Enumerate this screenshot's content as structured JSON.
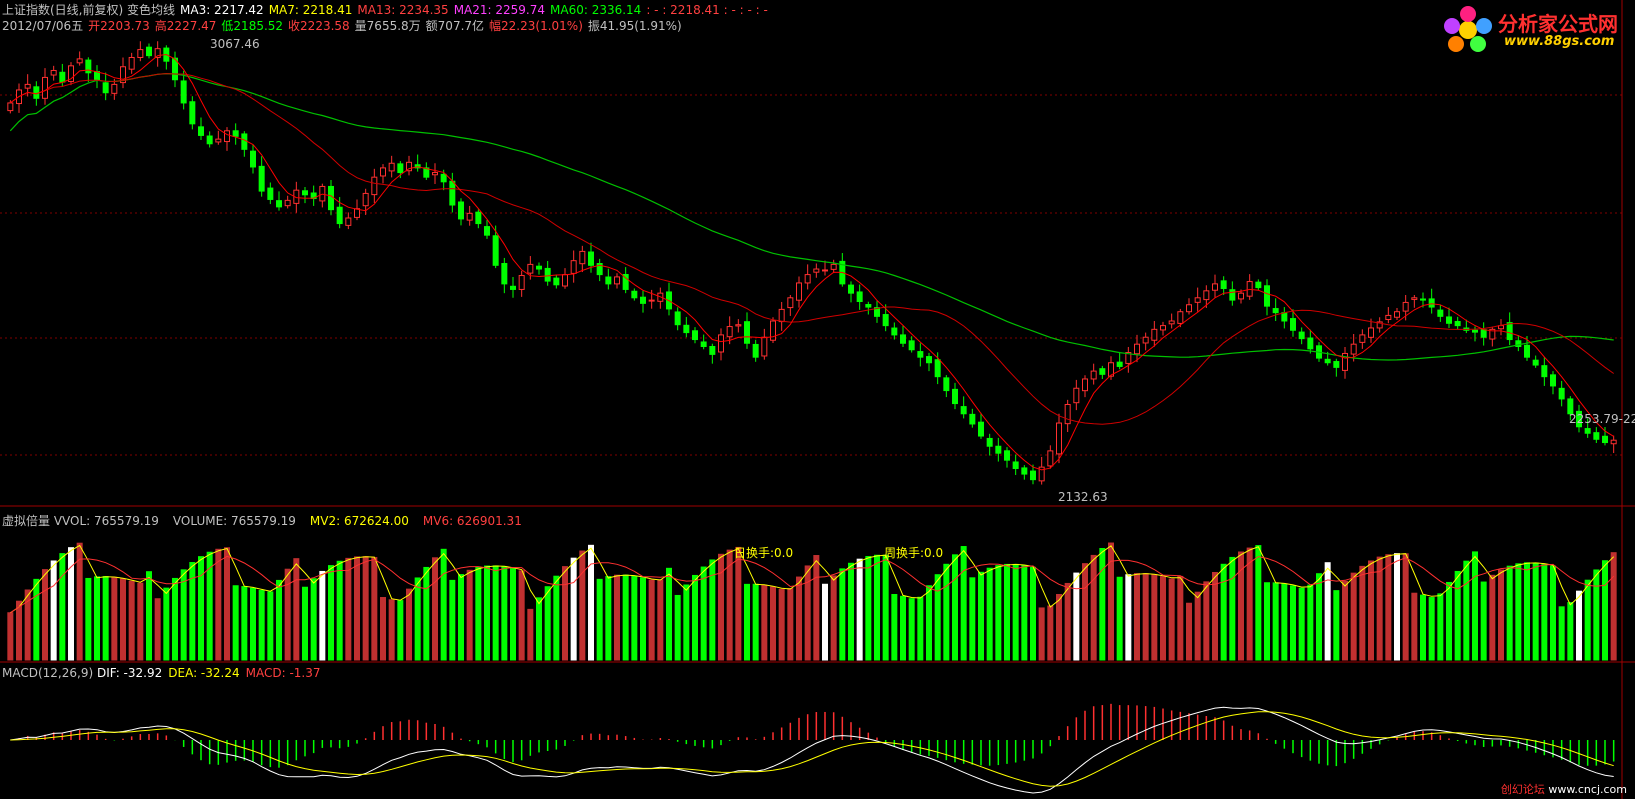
{
  "header": {
    "line1": [
      {
        "text": "上证指数(日线,前复权) 变色均线",
        "color": "#c0c0c0"
      },
      {
        "text": "MA3: 2217.42",
        "color": "#ffffff"
      },
      {
        "text": "MA7: 2218.41",
        "color": "#ffff00"
      },
      {
        "text": "MA13: 2234.35",
        "color": "#ff4040"
      },
      {
        "text": "MA21: 2259.74",
        "color": "#ff40ff"
      },
      {
        "text": "MA60: 2336.14",
        "color": "#00ff00"
      },
      {
        "text": ": - : 2218.41 : - : - : -",
        "color": "#ff4040"
      }
    ],
    "line2": [
      {
        "text": "2012/07/06五",
        "color": "#c0c0c0"
      },
      {
        "text": "开2203.73",
        "color": "#ff4040"
      },
      {
        "text": "高2227.47",
        "color": "#ff4040"
      },
      {
        "text": "低2185.52",
        "color": "#00ff00"
      },
      {
        "text": "收2223.58",
        "color": "#ff4040"
      },
      {
        "text": "量7655.8万",
        "color": "#c0c0c0"
      },
      {
        "text": "额707.7亿",
        "color": "#c0c0c0"
      },
      {
        "text": "幅22.23(1.01%)",
        "color": "#ff4040"
      },
      {
        "text": "振41.95(1.91%)",
        "color": "#c0c0c0"
      }
    ]
  },
  "logo": {
    "title": "分析家公式网",
    "url": "www.88gs.com"
  },
  "watermark": {
    "text": "www.cncj.com",
    "prefix": "创幻论坛"
  },
  "colors": {
    "up": "#ff3030",
    "down": "#00ff00",
    "white": "#ffffff",
    "grid": "#800000",
    "ma60": "#00c000",
    "ma_red": "#ff0000"
  },
  "chart_data": [
    {
      "type": "candlestick",
      "title": "上证指数(日线,前复权) 变色均线",
      "annotations": {
        "high": "3067.46",
        "low": "2132.63",
        "last": "2253.79-22"
      },
      "series": [
        {
          "name": "MA3",
          "value": 2217.42
        },
        {
          "name": "MA7",
          "value": 2218.41
        },
        {
          "name": "MA13",
          "value": 2234.35
        },
        {
          "name": "MA21",
          "value": 2259.74
        },
        {
          "name": "MA60",
          "value": 2336.14
        }
      ],
      "closes": [
        2950,
        2978,
        2990,
        2960,
        3005,
        3020,
        2995,
        3030,
        3045,
        3015,
        3000,
        2972,
        2990,
        3028,
        3048,
        3065,
        3052,
        3067,
        3040,
        3000,
        2950,
        2905,
        2880,
        2862,
        2872,
        2890,
        2878,
        2850,
        2812,
        2760,
        2742,
        2726,
        2740,
        2762,
        2752,
        2744,
        2770,
        2720,
        2690,
        2702,
        2722,
        2755,
        2790,
        2810,
        2820,
        2800,
        2822,
        2810,
        2790,
        2800,
        2780,
        2730,
        2700,
        2712,
        2690,
        2665,
        2600,
        2560,
        2548,
        2578,
        2602,
        2592,
        2566,
        2558,
        2580,
        2610,
        2630,
        2600,
        2580,
        2560,
        2575,
        2548,
        2530,
        2518,
        2525,
        2540,
        2506,
        2472,
        2455,
        2440,
        2425,
        2408,
        2450,
        2468,
        2472,
        2432,
        2402,
        2445,
        2480,
        2505,
        2530,
        2562,
        2580,
        2592,
        2590,
        2602,
        2560,
        2540,
        2522,
        2510,
        2490,
        2470,
        2450,
        2432,
        2418,
        2402,
        2390,
        2360,
        2330,
        2302,
        2280,
        2258,
        2232,
        2210,
        2195,
        2180,
        2162,
        2150,
        2138,
        2165,
        2200,
        2260,
        2300,
        2335,
        2355,
        2372,
        2365,
        2390,
        2382,
        2412,
        2430,
        2445,
        2462,
        2470,
        2480,
        2500,
        2515,
        2530,
        2545,
        2560,
        2550,
        2525,
        2540,
        2565,
        2552,
        2512,
        2498,
        2480,
        2460,
        2442,
        2420,
        2400,
        2390,
        2380,
        2410,
        2430,
        2450,
        2465,
        2478,
        2492,
        2500,
        2520,
        2530,
        2525,
        2510,
        2490,
        2475,
        2470,
        2460,
        2456,
        2445,
        2462,
        2470,
        2440,
        2425,
        2402,
        2385,
        2360,
        2340,
        2312,
        2280,
        2252,
        2238,
        2225,
        2218,
        2223
      ]
    },
    {
      "type": "bar",
      "title": "虚拟倍量",
      "series": [
        {
          "name": "VVOL",
          "value": 765579.19
        },
        {
          "name": "VOLUME",
          "value": 765579.19
        },
        {
          "name": "MV2",
          "value": 672624.0
        },
        {
          "name": "MV6",
          "value": 626901.31
        }
      ],
      "labels": {
        "daily_turnover": "日换手:0.0",
        "weekly_turnover": "周换手:0.0"
      }
    },
    {
      "type": "line",
      "title": "MACD(12,26,9)",
      "series": [
        {
          "name": "DIF",
          "value": -32.92
        },
        {
          "name": "DEA",
          "value": -32.24
        },
        {
          "name": "MACD",
          "value": -1.37
        }
      ]
    }
  ]
}
